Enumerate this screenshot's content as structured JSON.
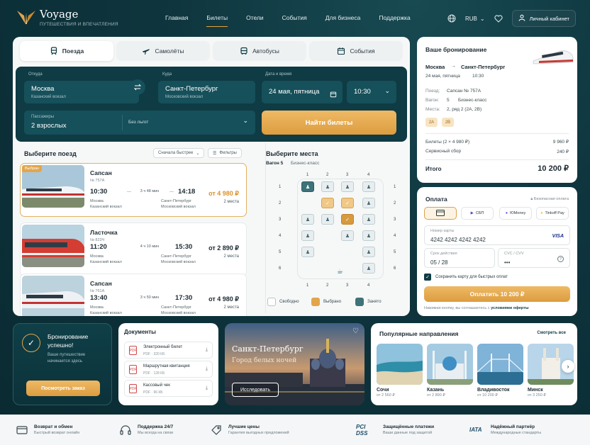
{
  "brand": {
    "name": "Voyage",
    "tagline": "ПУТЕШЕСТВИЯ И ВПЕЧАТЛЕНИЯ"
  },
  "nav": [
    "Главная",
    "Билеты",
    "Отели",
    "События",
    "Для бизнеса",
    "Поддержка"
  ],
  "header": {
    "currency": "RUB",
    "account": "Личный кабинет"
  },
  "tabs": [
    "Поезда",
    "Самолёты",
    "Автобусы",
    "События"
  ],
  "search": {
    "from_label": "Откуда",
    "from": "Москва",
    "from_sub": "Казанский вокзал",
    "to_label": "Куда",
    "to": "Санкт-Петербург",
    "to_sub": "Московский вокзал",
    "date_label": "Дата и время",
    "date": "24 мая, пятница",
    "time": "10:30",
    "pax_label": "Пассажиры",
    "pax": "2 взрослых",
    "discount": "Без льгот",
    "find": "Найти билеты"
  },
  "trains": {
    "title": "Выберите поезд",
    "sort": "Сначала быстрее",
    "filters": "Фильтры",
    "selected_badge": "Выбран",
    "items": [
      {
        "name": "Сапсан",
        "no": "№ 757А",
        "dep": "10:30",
        "arr": "14:18",
        "dur": "3 ч 48 мин",
        "from": "Москва",
        "from_st": "Казанский вокзал",
        "to": "Санкт-Петербург",
        "to_st": "Московский вокзал",
        "price": "от 4 980 ₽",
        "seats": "2 места"
      },
      {
        "name": "Ласточка",
        "no": "№ 823Ч",
        "dep": "11:20",
        "arr": "15:30",
        "dur": "4 ч 10 мин",
        "from": "Москва",
        "from_st": "Казанский вокзал",
        "to": "Санкт-Петербург",
        "to_st": "Московский вокзал",
        "price": "от 2 890 ₽",
        "seats": "2 места"
      },
      {
        "name": "Сапсан",
        "no": "№ 761А",
        "dep": "13:40",
        "arr": "17:30",
        "dur": "3 ч 50 мин",
        "from": "Москва",
        "from_st": "Казанский вокзал",
        "to": "Санкт-Петербург",
        "to_st": "Московский вокзал",
        "price": "от 4 980 ₽",
        "seats": "2 места"
      }
    ]
  },
  "seats": {
    "title": "Выберите места",
    "wagon": "Вагон 5",
    "cls": "Бизнес-класс",
    "cols": [
      "1",
      "2",
      "3",
      "4"
    ],
    "rows": [
      "1",
      "2",
      "3",
      "4",
      "5",
      "6"
    ],
    "legend": [
      "Свободно",
      "Выбрано",
      "Занято"
    ]
  },
  "summary": {
    "title": "Ваше бронирование",
    "from": "Москва",
    "to": "Санкт-Петербург",
    "when": "24 мая, пятница",
    "time": "10:30",
    "train_l": "Поезд:",
    "train": "Сапсан № 757А",
    "wagon_l": "Вагон:",
    "wagon": "5",
    "wagon_cls": "Бизнес-класс",
    "seats_l": "Места:",
    "seats": "2, ряд 2 (2А, 2В)",
    "chips": [
      "2А",
      "2В"
    ],
    "tickets_l": "Билеты (2 × 4 980 ₽)",
    "tickets": "9 960 ₽",
    "fee_l": "Сервисный сбор",
    "fee": "240 ₽",
    "total_l": "Итого",
    "total": "10 200 ₽"
  },
  "payment": {
    "title": "Оплата",
    "secure": "Безопасная оплата",
    "methods": [
      "",
      "СБП",
      "ЮMoney",
      "Tinkoff Pay"
    ],
    "card_l": "Номер карты",
    "card": "4242 4242 4242 4242",
    "visa": "VISA",
    "exp_l": "Срок действия",
    "exp": "05 / 28",
    "cvc_l": "CVC / CVV",
    "cvc": "•••",
    "save": "Сохранить карту для быстрых оплат",
    "pay": "Оплатить 10 200 ₽",
    "agree": "Нажимая кнопку, вы соглашаетесь с",
    "agree_link": "условиями оферты"
  },
  "success": {
    "title": "Бронирование успешно!",
    "sub": "Ваше путешествие начинается здесь",
    "btn": "Посмотреть заказ"
  },
  "docs": {
    "title": "Документы",
    "items": [
      {
        "n": "Электронный билет",
        "m": "PDF · 320 КБ"
      },
      {
        "n": "Маршрутная квитанция",
        "m": "PDF · 128 КБ"
      },
      {
        "n": "Кассовый чек",
        "m": "PDF · 96 КБ"
      }
    ]
  },
  "promo": {
    "title": "Санкт-Петербург",
    "sub": "Город белых ночей",
    "btn": "Исследовать"
  },
  "popular": {
    "title": "Популярные направления",
    "all": "Смотреть все",
    "items": [
      {
        "n": "Сочи",
        "p": "от 2 560 ₽"
      },
      {
        "n": "Казань",
        "p": "от 2 890 ₽"
      },
      {
        "n": "Владивосток",
        "p": "от 10 200 ₽"
      },
      {
        "n": "Минск",
        "p": "от 3 250 ₽"
      }
    ]
  },
  "footer": [
    {
      "t": "Возврат и обмен",
      "s": "Быстрый возврат онлайн"
    },
    {
      "t": "Поддержка 24/7",
      "s": "Мы всегда на связи"
    },
    {
      "t": "Лучшие цены",
      "s": "Гарантия выгодных предложений"
    },
    {
      "t": "Защищённые платежи",
      "s": "Ваши данные под защитой",
      "mark": "PCI DSS"
    },
    {
      "t": "Надёжный партнёр",
      "s": "Международные стандарты",
      "mark": "IATA"
    }
  ],
  "colors": {
    "accent": "#e2a54b",
    "brand_dark": "#0e3b44",
    "busy": "#3e7379"
  }
}
